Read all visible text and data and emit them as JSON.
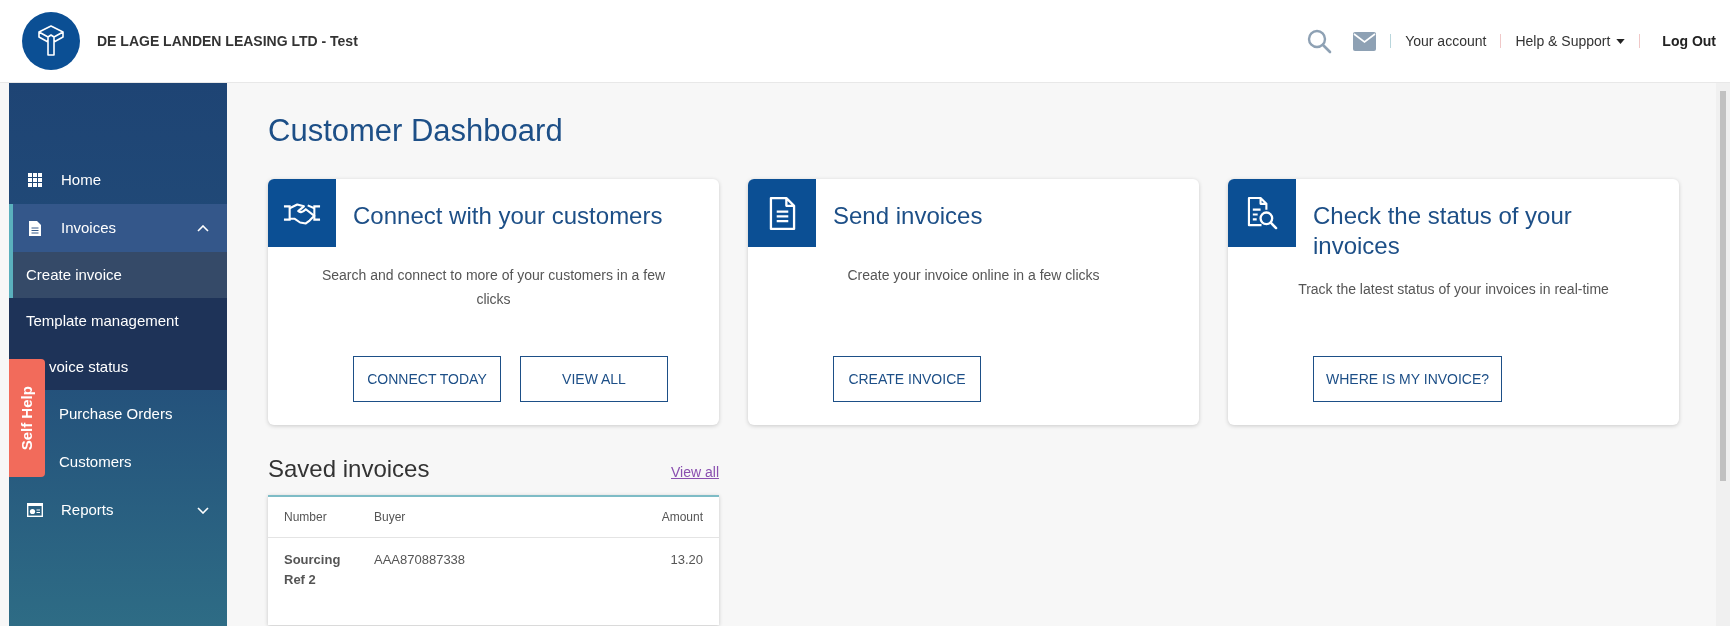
{
  "header": {
    "company": "DE LAGE LANDEN LEASING LTD - Test",
    "links": [
      {
        "label": "Your account",
        "kind": "link"
      },
      {
        "label": "Help & Support",
        "kind": "dropdown"
      },
      {
        "label": "Log Out",
        "kind": "strong"
      }
    ]
  },
  "sidebar": {
    "items": [
      {
        "label": "Home",
        "selected": false
      },
      {
        "label": "Invoices",
        "selected": true,
        "expanded": true,
        "children": [
          {
            "label": "Create invoice",
            "selected": true
          },
          {
            "label": "Template management",
            "selected": false
          },
          {
            "label": "voice status",
            "selected": false
          }
        ]
      },
      {
        "label": "Purchase Orders",
        "selected": false
      },
      {
        "label": "Customers",
        "selected": false
      },
      {
        "label": "Reports",
        "selected": false,
        "expanded": false
      }
    ]
  },
  "self_help_tab": {
    "label": "Self Help"
  },
  "page_title": "Customer Dashboard",
  "cards": [
    {
      "title": "Connect with your customers",
      "description": "Search and connect to more of your customers in a few clicks",
      "buttons": [
        "CONNECT TODAY",
        "VIEW ALL"
      ]
    },
    {
      "title": "Send invoices",
      "description": "Create your invoice online in a few clicks",
      "buttons": [
        "CREATE INVOICE"
      ]
    },
    {
      "title": "Check the status of your invoices",
      "description": "Track the latest status of your invoices in real-time",
      "buttons": [
        "WHERE IS MY INVOICE?"
      ]
    }
  ],
  "saved_invoices": {
    "title": "Saved invoices",
    "link": "View all",
    "columns": [
      "Number",
      "Buyer",
      "Amount"
    ],
    "rows": [
      [
        "Sourcing Ref 2",
        "AAA870887338",
        "13.20"
      ]
    ]
  }
}
